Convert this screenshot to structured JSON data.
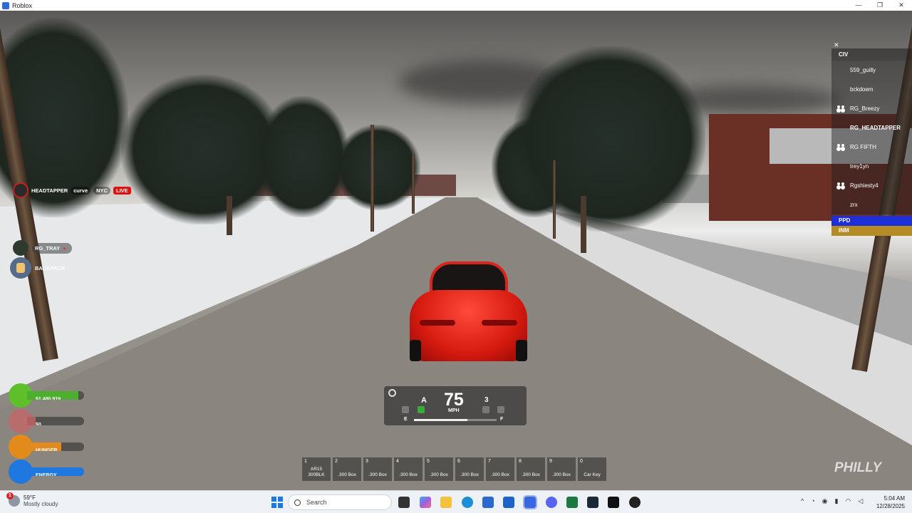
{
  "window": {
    "title": "Roblox",
    "controls": [
      "—",
      "❐",
      "✕"
    ]
  },
  "player": {
    "name": "HEADTAPPER",
    "tags": [
      "curve",
      "NYC"
    ],
    "live_label": "LIVE",
    "faint_rows": [
      "",
      ""
    ]
  },
  "companion": {
    "name": "RG_TRAY"
  },
  "backpack": {
    "label": "BACKPACK"
  },
  "stats": [
    {
      "name": "money",
      "label": "$1,480,919",
      "fill": 0.9,
      "color": "#4caf2e",
      "icon_color": "#5fbf2a"
    },
    {
      "name": "dirty",
      "label": "$0",
      "fill": 0.0,
      "color": "#b06060",
      "icon_color": "#b86c6c"
    },
    {
      "name": "hunger",
      "label": "HUNGER",
      "fill": 0.6,
      "color": "#e08a20",
      "icon_color": "#e28a1a"
    },
    {
      "name": "energy",
      "label": "ENERGY",
      "fill": 1.0,
      "color": "#1e78e0",
      "icon_color": "#1e78e0"
    }
  ],
  "speedometer": {
    "gear_mode": "A",
    "speed": "75",
    "unit": "MPH",
    "gear": "3",
    "fuel_empty": "E",
    "fuel_full": "F",
    "fuel_level": 0.65
  },
  "hotbar": [
    {
      "num": "1",
      "label": "AR15 300BLK"
    },
    {
      "num": "2",
      "label": ".300 Box"
    },
    {
      "num": "3",
      "label": ".300 Box"
    },
    {
      "num": "4",
      "label": ".300 Box"
    },
    {
      "num": "5",
      "label": ".300 Box"
    },
    {
      "num": "6",
      "label": ".300 Box"
    },
    {
      "num": "7",
      "label": ".300 Box"
    },
    {
      "num": "8",
      "label": ".300 Box"
    },
    {
      "num": "9",
      "label": ".300 Box"
    },
    {
      "num": "0",
      "label": "Car Key"
    }
  ],
  "team_panel": {
    "close": "✕",
    "header": "CIV",
    "entries": [
      {
        "name": "559_guilly",
        "group": false,
        "bold": false
      },
      {
        "name": "bckdoem",
        "group": false,
        "bold": false
      },
      {
        "name": "RG_Breezy",
        "group": true,
        "bold": false
      },
      {
        "name": "RG_HEADTAPPER",
        "group": false,
        "bold": true
      },
      {
        "name": "RG FIFTH",
        "group": true,
        "bold": false
      },
      {
        "name": "trey1yn",
        "group": false,
        "bold": false
      },
      {
        "name": "Rgshiesty4",
        "group": true,
        "bold": false
      },
      {
        "name": "zrx",
        "group": false,
        "bold": false
      }
    ],
    "ppd": "PPD",
    "inm": "INM"
  },
  "watermark": "PHILLY",
  "taskbar": {
    "weather_temp": "59°F",
    "weather_desc": "Mostly cloudy",
    "weather_badge": "1",
    "search_placeholder": "Search",
    "time": "5:04 AM",
    "date": "12/28/2025",
    "tray_chevron": "^"
  }
}
